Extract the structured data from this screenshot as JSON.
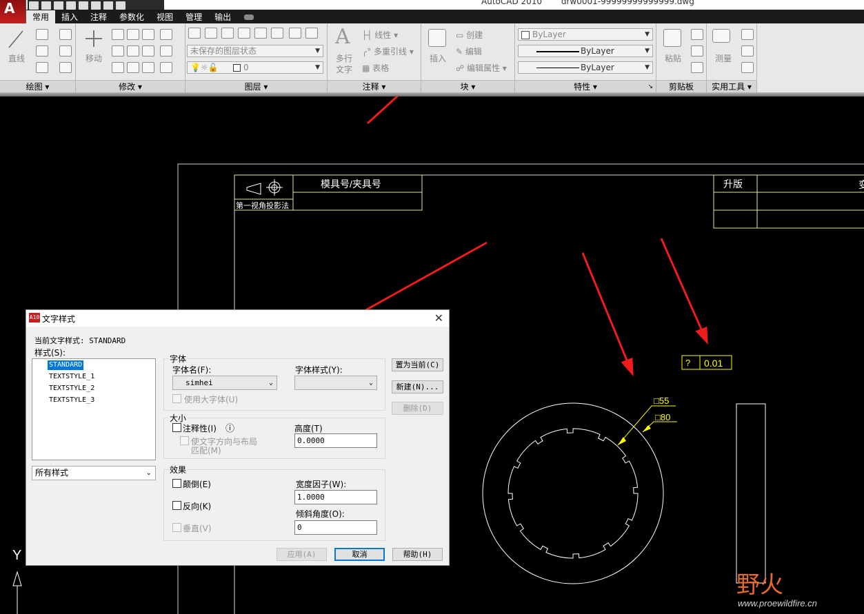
{
  "titlebar": {
    "app": "AutoCAD 2010",
    "file": "drw0001-99999999999999.dwg"
  },
  "tabs": [
    "常用",
    "插入",
    "注释",
    "参数化",
    "视图",
    "管理",
    "输出"
  ],
  "ribbon": {
    "draw": {
      "line": "直线",
      "footer": "绘图 ▾"
    },
    "modify": {
      "move": "移动",
      "footer": "修改 ▾"
    },
    "layer": {
      "state": "未保存的图层状态",
      "current": "0",
      "footer": "图层 ▾"
    },
    "annotation": {
      "mtext": "多行",
      "text": "文字",
      "linear": "线性",
      "mleader": "多重引线",
      "table": "表格",
      "footer": "注释 ▾"
    },
    "block": {
      "insert": "插入",
      "create": "创建",
      "edit": "编辑",
      "attr": "编辑属性",
      "footer": "块 ▾"
    },
    "properties": {
      "color": "ByLayer",
      "linetype": "ByLayer",
      "lineweight": "ByLayer",
      "footer": "特性 ▾",
      "launcher": "↘"
    },
    "clipboard": {
      "paste": "粘贴",
      "footer": "剪贴板"
    },
    "utilities": {
      "measure": "测量",
      "footer": "实用工具 ▾"
    }
  },
  "drawing": {
    "projection": "第一视角投影法",
    "moldno": "模具号/夹具号",
    "rev": "升版",
    "rev_right": "变",
    "tol_sym": "?",
    "tol_val": "0.01",
    "dim1": "□55",
    "dim2": "□80",
    "ucs": "Y",
    "watermark": "野火",
    "watermark_url": "www.proewildfire.cn"
  },
  "dialog": {
    "title": "文字样式",
    "current_label": "当前文字样式: STANDARD",
    "styles_label": "样式(S):",
    "styles": [
      "STANDARD",
      "TEXTSTYLE_1",
      "TEXTSTYLE_2",
      "TEXTSTYLE_3"
    ],
    "filter": "所有样式",
    "font_group": "字体",
    "font_name_label": "字体名(F):",
    "font_name": "simhei",
    "font_style_label": "字体样式(Y):",
    "bigfont": "使用大字体(U)",
    "size_group": "大小",
    "annotative": "注释性(I)",
    "match_orient": "使文字方向与布局",
    "match_orient2": "匹配(M)",
    "height_label": "高度(T)",
    "height": "0.0000",
    "effects_group": "效果",
    "upside": "颠倒(E)",
    "backwards": "反向(K)",
    "vertical": "垂直(V)",
    "width_label": "宽度因子(W):",
    "width": "1.0000",
    "oblique_label": "倾斜角度(O):",
    "oblique": "0",
    "set_current": "置为当前(C)",
    "new": "新建(N)...",
    "delete": "删除(D)",
    "apply": "应用(A)",
    "cancel": "取消",
    "help": "帮助(H)"
  }
}
